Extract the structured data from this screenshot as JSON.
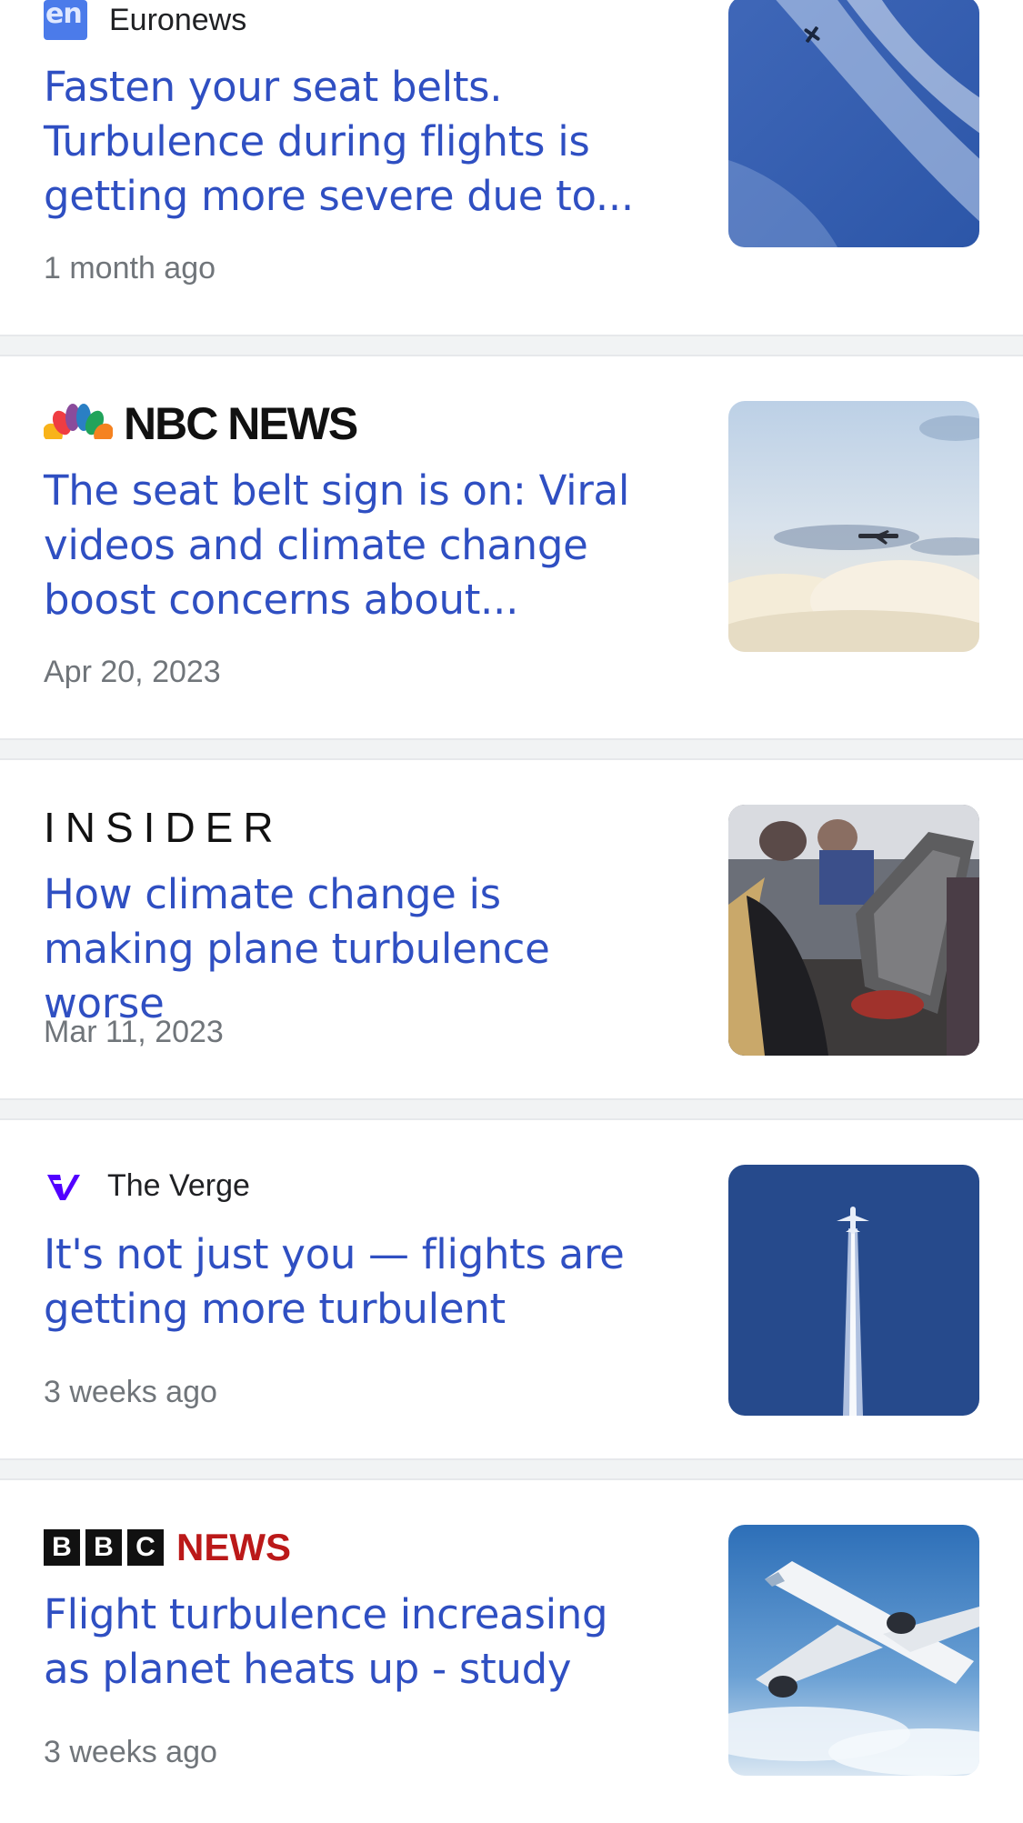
{
  "articles": [
    {
      "source": "Euronews",
      "source_logo_text": "en",
      "headline": "Fasten your seat belts. Turbulence during flights is getting more severe due to...",
      "time": "1 month ago",
      "thumbnail": "plane-in-blue-sky-with-cirrus-clouds"
    },
    {
      "source": "NBC NEWS",
      "headline": "The seat belt sign is on: Viral videos and climate change boost concerns about...",
      "time": "Apr 20, 2023",
      "thumbnail": "plane-flying-over-clouds"
    },
    {
      "source": "INSIDER",
      "headline": "How climate change is making plane turbulence worse",
      "time": "Mar 11, 2023",
      "thumbnail": "damaged-airplane-cabin-interior"
    },
    {
      "source": "The Verge",
      "headline": "It's not just you — flights are getting more turbulent",
      "time": "3 weeks ago",
      "thumbnail": "plane-with-contrail-in-dark-blue-sky"
    },
    {
      "source": "BBC",
      "source_suffix": "NEWS",
      "bbc_letters": [
        "B",
        "B",
        "C"
      ],
      "headline": "Flight turbulence increasing as planet heats up - study",
      "time": "3 weeks ago",
      "thumbnail": "airliner-above-clouds"
    }
  ],
  "colors": {
    "headline": "#2f4fc2",
    "meta": "#70757a",
    "separator": "#f1f3f4",
    "bbc_red": "#bb1919"
  }
}
